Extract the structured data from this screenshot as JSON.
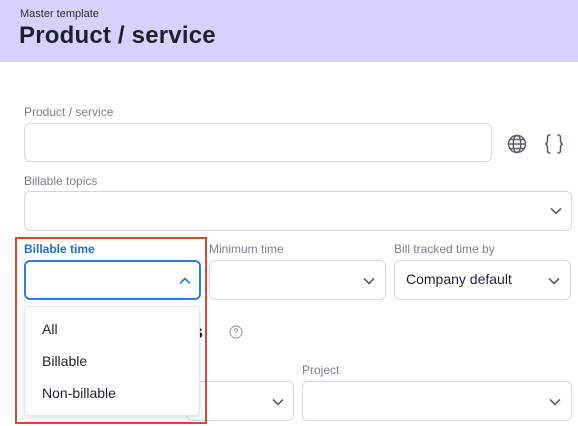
{
  "header": {
    "subtitle": "Master template",
    "title": "Product / service"
  },
  "form": {
    "product_label": "Product / service",
    "product_value": "",
    "billable_topics_label": "Billable topics",
    "billable_time_label": "Billable time",
    "minimum_time_label": "Minimum time",
    "bill_tracked_label": "Bill tracked time by",
    "bill_tracked_value": "Company default",
    "section_heading_partial": "rs",
    "project_label": "Project"
  },
  "dropdown": {
    "options": [
      "All",
      "Billable",
      "Non-billable"
    ]
  },
  "icons": {
    "globe": "globe-icon",
    "braces": "braces-icon",
    "chevron": "chevron-down-icon",
    "help": "help-icon"
  },
  "colors": {
    "header_bg": "#d7d2fb",
    "focus_blue": "#2f7fcf",
    "highlight_red": "#d84a2a"
  }
}
